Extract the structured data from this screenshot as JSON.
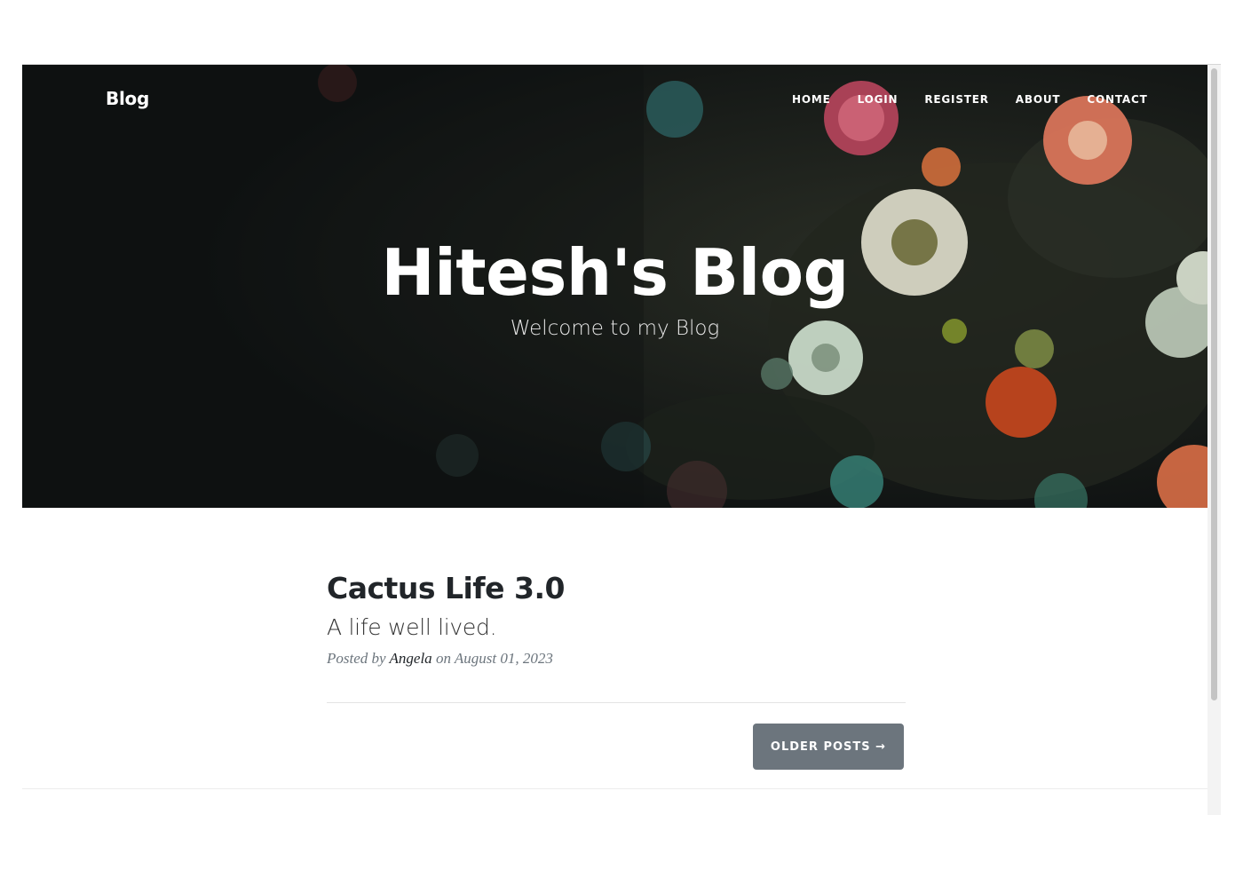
{
  "nav": {
    "brand": "Blog",
    "links": [
      "HOME",
      "LOGIN",
      "REGISTER",
      "ABOUT",
      "CONTACT"
    ]
  },
  "hero": {
    "title": "Hitesh's Blog",
    "subtitle": "Welcome to my Blog"
  },
  "posts": [
    {
      "title": "Cactus Life 3.0",
      "subtitle": "A life well lived.",
      "meta_prefix": "Posted by",
      "author": "Angela",
      "meta_on": "on",
      "date": "August 01, 2023"
    }
  ],
  "pager": {
    "older_label": "OLDER POSTS →"
  },
  "colors": {
    "hero_bg": "#0f1212",
    "button_bg": "#6c757d",
    "text_dark": "#212529",
    "text_muted": "#6c757d"
  }
}
